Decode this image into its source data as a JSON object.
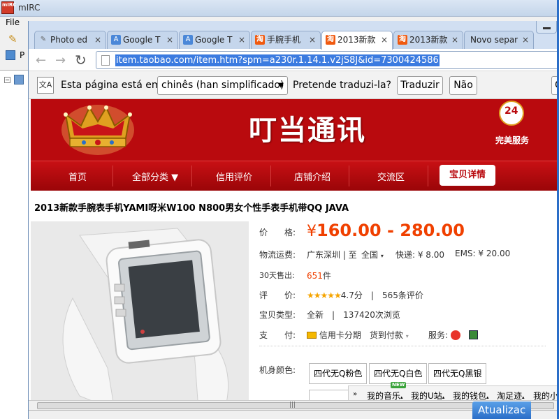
{
  "mirc": {
    "logo_text": "mIRC",
    "title": "mIRC",
    "menu_file": "File",
    "toolbar_label": "P",
    "tree_expander": "−"
  },
  "browser": {
    "tabs": [
      {
        "label": "Photo ed",
        "icon": "pen-icon"
      },
      {
        "label": "Google T",
        "icon": "google-translate-icon"
      },
      {
        "label": "Google T",
        "icon": "google-translate-icon"
      },
      {
        "label": "手腕手机",
        "icon": "taobao-icon"
      },
      {
        "label": "2013新款",
        "icon": "taobao-icon"
      },
      {
        "label": "2013新款",
        "icon": "taobao-icon"
      },
      {
        "label": "Novo separ",
        "icon": ""
      }
    ],
    "tab_close": "×",
    "url": "item.taobao.com/item.htm?spm=a230r.1.14.1.v2jS8J&id=7300424586"
  },
  "translate_bar": {
    "intro": "Esta página está em",
    "language": "chinês (han simplificado)",
    "question": "Pretende traduzi-la?",
    "translate_button": "Traduzir",
    "no_button": "Não",
    "options_button": "O"
  },
  "shop": {
    "name": "叮当通讯",
    "service_badge": "24",
    "service_text": "完美服务",
    "nav": [
      "首页",
      "全部分类 ▼",
      "信用评价",
      "店铺介绍",
      "交流区"
    ],
    "nav_active": "宝贝详情"
  },
  "item": {
    "title": "2013新款手腕表手机YAMI呀米W100 N800男女个性手表手机带QQ JAVA",
    "price_label": "价　　格:",
    "price_symbol": "¥",
    "price": "160.00 - 280.00",
    "shipping_label": "物流运费:",
    "shipping_from": "广东深圳 | 至",
    "shipping_to": "全国",
    "express": "快递: ¥ 8.00",
    "ems": "EMS: ¥ 20.00",
    "sold_label": "30天售出:",
    "sold_count": "651",
    "sold_unit": "件",
    "rating_label": "评　　价:",
    "stars": "★★★★★",
    "rating": "4.7分",
    "reviews": "565条评价",
    "type_label": "宝贝类型:",
    "type_value": "全新",
    "views": "137420次浏览",
    "pay_label": "支　　付:",
    "pay_credit": "信用卡分期",
    "pay_cod": "货到付款",
    "service_label": "服务:",
    "color_label": "机身颜色:",
    "colors": [
      "四代无Q粉色",
      "四代无Q白色",
      "四代无Q黑银"
    ]
  },
  "bottom_bar": {
    "badge": "NEW",
    "items": [
      "我的音乐",
      "我的U站",
      "我的钱包",
      "淘足迹",
      "我的小"
    ]
  },
  "update_button": "Atualizac"
}
